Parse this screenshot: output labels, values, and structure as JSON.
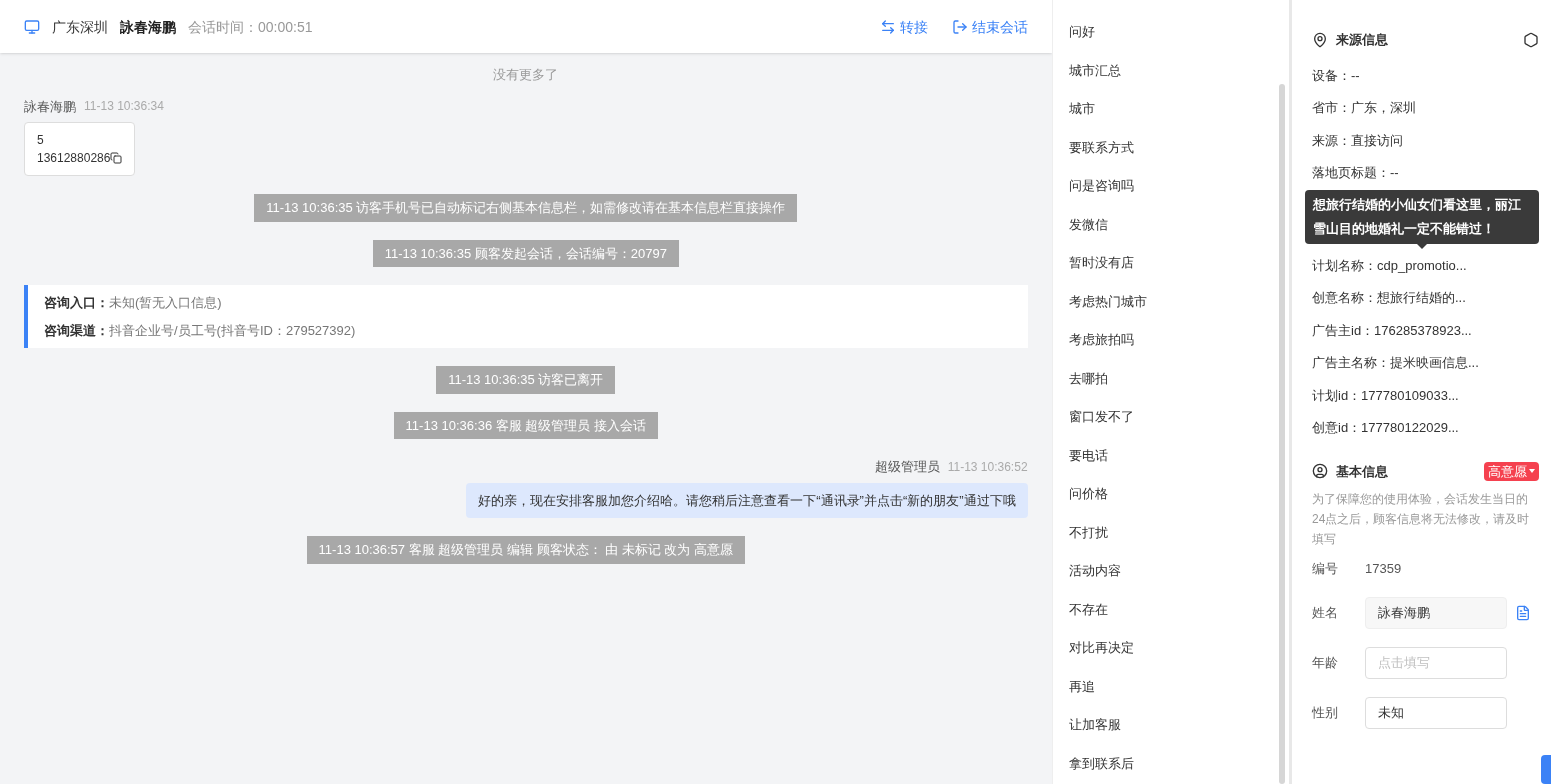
{
  "header": {
    "location": "广东深圳",
    "visitor": "詠春海鹏",
    "session_time": "会话时间：00:00:51",
    "actions": [
      {
        "kind": "transfer",
        "label": "转接"
      },
      {
        "kind": "end",
        "label": "结束会话"
      }
    ]
  },
  "chat": {
    "no_more": "没有更多了",
    "messages": [
      {
        "kind": "visitor",
        "sender": "詠春海鹏",
        "time": "11-13 10:36:34",
        "lines": [
          "5",
          "13612880286"
        ]
      },
      {
        "kind": "system",
        "text": "11-13 10:36:35 访客手机号已自动标记右侧基本信息栏，如需修改请在基本信息栏直接操作"
      },
      {
        "kind": "system",
        "text": "11-13 10:36:35 顾客发起会话，会话编号：20797"
      },
      {
        "kind": "info",
        "rows": [
          {
            "label": "咨询入口：",
            "value": "未知(暂无入口信息)"
          },
          {
            "label": "咨询渠道：",
            "value": "抖音企业号/员工号(抖音号ID：279527392)"
          }
        ]
      },
      {
        "kind": "system",
        "text": "11-13 10:36:35 访客已离开"
      },
      {
        "kind": "system",
        "text": "11-13 10:36:36 客服 超级管理员 接入会话"
      },
      {
        "kind": "agent",
        "sender": "超级管理员",
        "time": "11-13 10:36:52",
        "text": "好的亲，现在安排客服加您介绍哈。请您稍后注意查看一下“通讯录”并点击“新的朋友”通过下哦"
      },
      {
        "kind": "system",
        "text": "11-13 10:36:57 客服 超级管理员 编辑 顾客状态： 由 未标记 改为 高意愿"
      }
    ]
  },
  "quick_replies": [
    "问好",
    "城市汇总",
    "城市",
    "要联系方式",
    "问是咨询吗",
    "发微信",
    "暂时没有店",
    "考虑热门城市",
    "考虑旅拍吗",
    "去哪拍",
    "窗口发不了",
    "要电话",
    "问价格",
    "不打扰",
    "活动内容",
    "不存在",
    "对比再决定",
    "再追",
    "让加客服",
    "拿到联系后"
  ],
  "source_info": {
    "title": "来源信息",
    "rows": [
      {
        "kind": "row",
        "text": "设备：--"
      },
      {
        "kind": "row",
        "text": "省市：广东，深圳"
      },
      {
        "kind": "row",
        "text": "来源：直接访问"
      },
      {
        "kind": "row",
        "text": "落地页标题：--"
      },
      {
        "kind": "tooltip",
        "text": "想旅行结婚的小仙女们看这里，丽江雪山目的地婚礼一定不能错过！"
      },
      {
        "kind": "row",
        "text": "计划名称：cdp_promotio..."
      },
      {
        "kind": "row",
        "text": "创意名称：想旅行结婚的..."
      },
      {
        "kind": "row",
        "text": "广告主id：176285378923..."
      },
      {
        "kind": "row",
        "text": "广告主名称：提米映画信息..."
      },
      {
        "kind": "row",
        "text": "计划id：177780109033..."
      },
      {
        "kind": "row",
        "text": "创意id：177780122029..."
      }
    ]
  },
  "basic_info": {
    "title": "基本信息",
    "tag": "高意愿",
    "notice": "为了保障您的使用体验，会话发生当日的24点之后，顾客信息将无法修改，请及时填写",
    "fields": [
      {
        "kind": "static",
        "label": "编号",
        "value": "17359"
      },
      {
        "kind": "readonly",
        "label": "姓名",
        "value": "詠春海鹏"
      },
      {
        "kind": "input",
        "label": "年龄",
        "placeholder": "点击填写"
      },
      {
        "kind": "input",
        "label": "性别",
        "value": "未知"
      }
    ]
  }
}
